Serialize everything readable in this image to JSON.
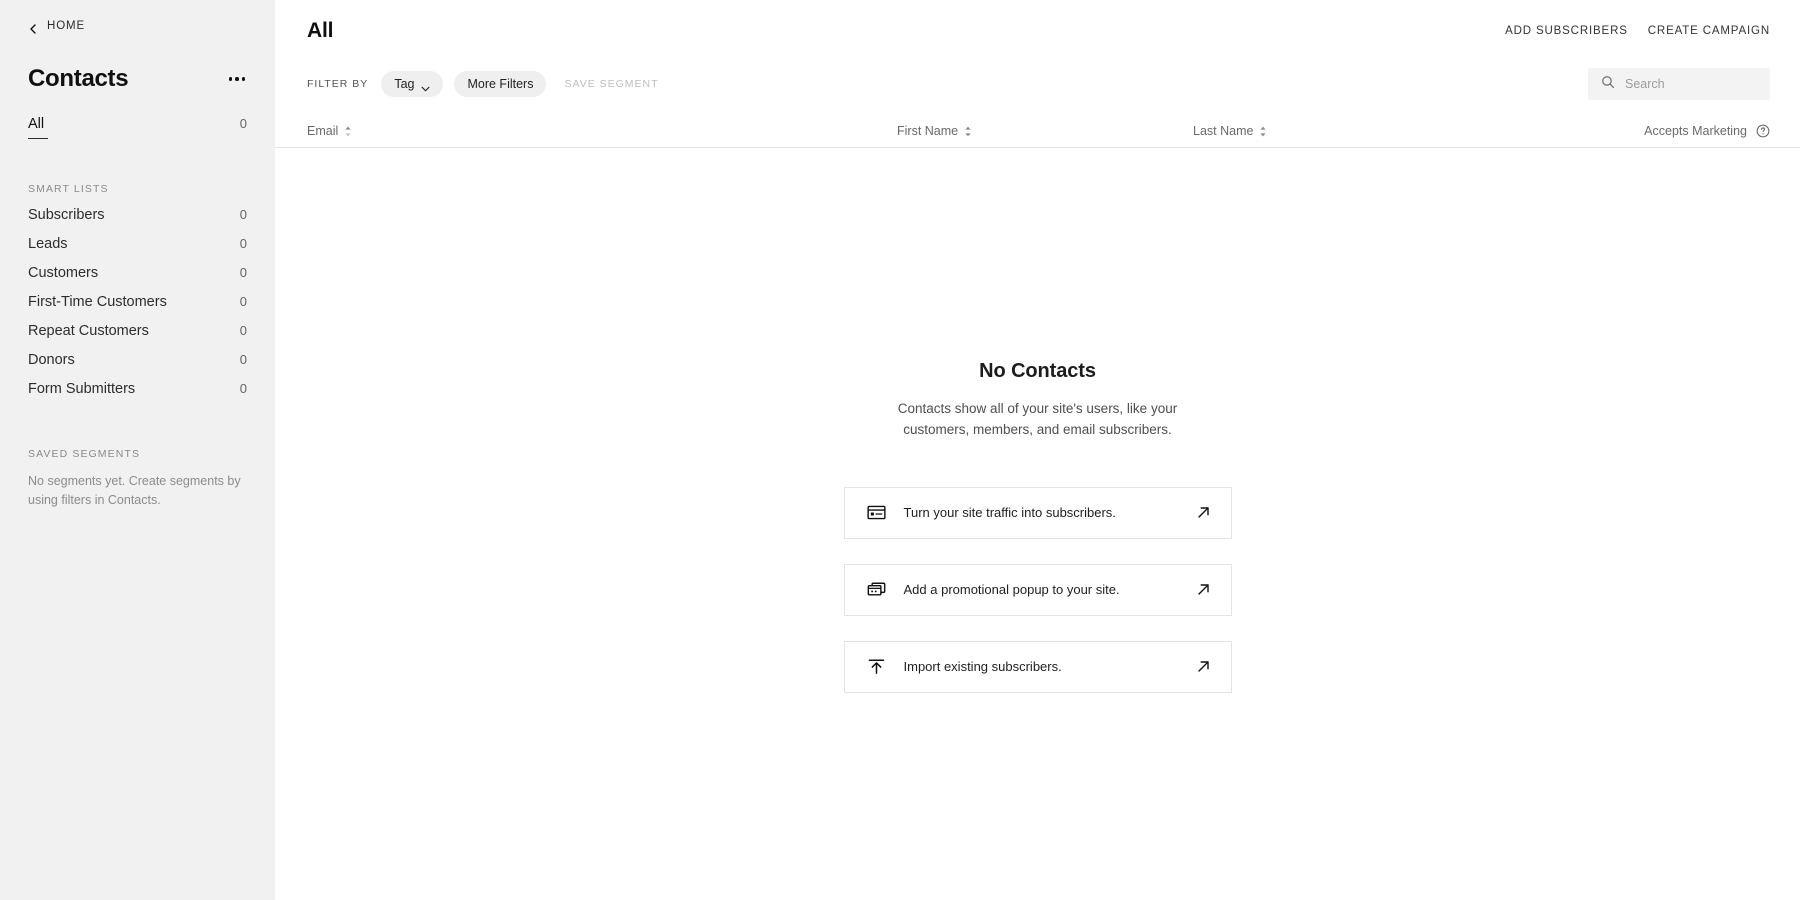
{
  "sidebar": {
    "home_label": "HOME",
    "home_icon": "chevron-left-icon",
    "title": "Contacts",
    "more_icon": "ellipsis-icon",
    "all": {
      "label": "All",
      "count": "0"
    },
    "smart_lists_label": "SMART LISTS",
    "smart_lists": [
      {
        "label": "Subscribers",
        "count": "0"
      },
      {
        "label": "Leads",
        "count": "0"
      },
      {
        "label": "Customers",
        "count": "0"
      },
      {
        "label": "First-Time Customers",
        "count": "0"
      },
      {
        "label": "Repeat Customers",
        "count": "0"
      },
      {
        "label": "Donors",
        "count": "0"
      },
      {
        "label": "Form Submitters",
        "count": "0"
      }
    ],
    "saved_segments_label": "SAVED SEGMENTS",
    "saved_segments_empty": "No segments yet. Create segments by using filters in Contacts."
  },
  "topbar": {
    "title": "All",
    "add_subscribers_label": "ADD SUBSCRIBERS",
    "create_campaign_label": "CREATE CAMPAIGN"
  },
  "filterbar": {
    "filter_by_label": "FILTER BY",
    "tag_label": "Tag",
    "tag_caret_icon": "chevron-down-icon",
    "more_filters_label": "More Filters",
    "save_segment_label": "SAVE SEGMENT",
    "search_icon": "search-icon",
    "search_placeholder": "Search",
    "search_value": ""
  },
  "table": {
    "columns": [
      {
        "label": "Email",
        "sort_icon": "sort-arrows-icon"
      },
      {
        "label": "First Name",
        "sort_icon": "sort-arrows-icon"
      },
      {
        "label": "Last Name",
        "sort_icon": "sort-arrows-icon"
      },
      {
        "label": "Accepts Marketing",
        "help_icon": "question-circle-icon"
      }
    ]
  },
  "empty_state": {
    "title": "No Contacts",
    "description": "Contacts show all of your site's users, like your customers, members, and email subscribers.",
    "cards": [
      {
        "icon": "banner-icon",
        "label": "Turn your site traffic into subscribers.",
        "arrow_icon": "arrow-up-right-icon"
      },
      {
        "icon": "popup-icon",
        "label": "Add a promotional popup to your site.",
        "arrow_icon": "arrow-up-right-icon"
      },
      {
        "icon": "upload-icon",
        "label": "Import existing subscribers.",
        "arrow_icon": "arrow-up-right-icon"
      }
    ]
  },
  "colors": {
    "sidebar_bg": "#f1f1f1",
    "main_bg": "#ffffff",
    "pill_bg": "#efefef",
    "muted_text": "#8a8a8a",
    "disabled_text": "#bdbdbd"
  }
}
